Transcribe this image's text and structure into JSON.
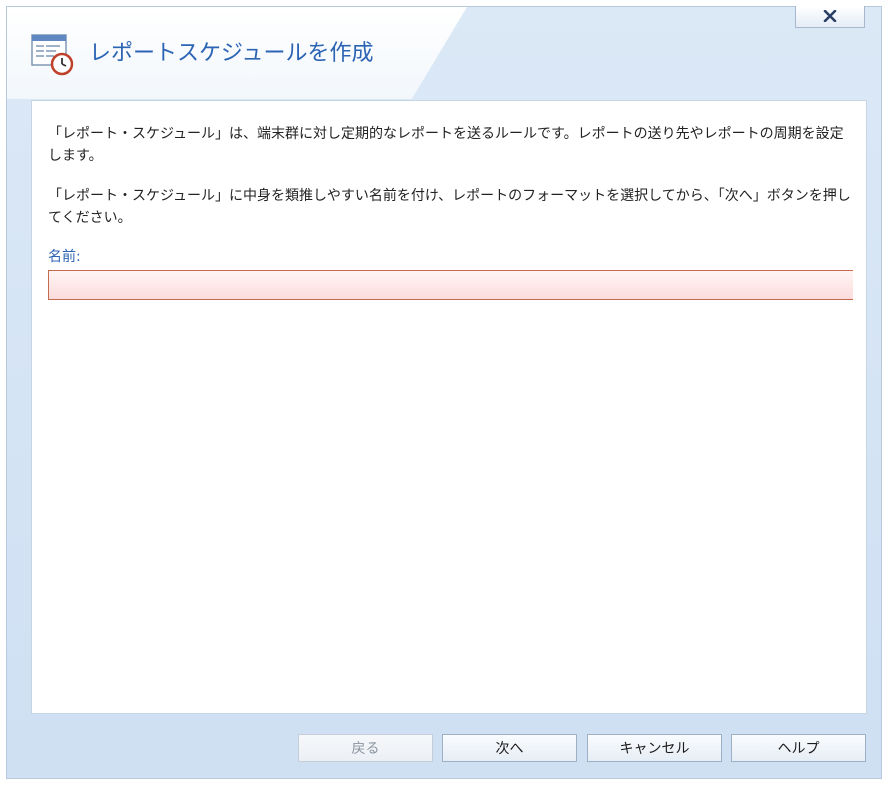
{
  "window": {
    "title": "レポートスケジュールを作成",
    "close_icon": "close-x-icon",
    "app_icon": "report-schedule-calendar-icon"
  },
  "content": {
    "paragraph1": "「レポート・スケジュール」は、端末群に対し定期的なレポートを送るルールです。レポートの送り先やレポートの周期を設定します。",
    "paragraph2": "「レポート・スケジュール」に中身を類推しやすい名前を付け、レポートのフォーマットを選択してから、「次へ」ボタンを押してください。",
    "name_label": "名前:",
    "name_value": "",
    "name_placeholder": ""
  },
  "buttons": {
    "back": "戻る",
    "next": "次へ",
    "cancel": "キャンセル",
    "help": "ヘルプ"
  },
  "colors": {
    "title": "#2c64b4",
    "invalid_field_border": "#c46a4e",
    "invalid_field_fill": "#fcdcdc"
  }
}
